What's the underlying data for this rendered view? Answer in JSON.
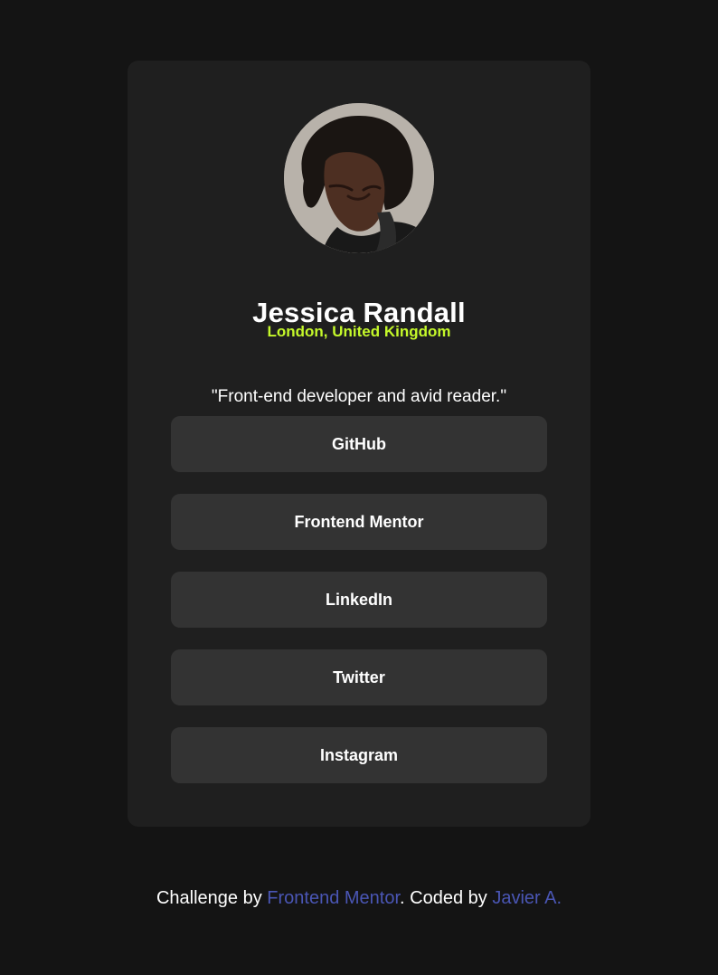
{
  "profile": {
    "name": "Jessica Randall",
    "location": "London, United Kingdom",
    "bio": "\"Front-end developer and avid reader.\"",
    "avatar_icon": "avatar-photo",
    "accent_color": "#c4f82a"
  },
  "links": [
    {
      "label": "GitHub"
    },
    {
      "label": "Frontend Mentor"
    },
    {
      "label": "LinkedIn"
    },
    {
      "label": "Twitter"
    },
    {
      "label": "Instagram"
    }
  ],
  "footer": {
    "prefix": "Challenge by ",
    "challenge_link": "Frontend Mentor",
    "middle": ". Coded by ",
    "author_link": "Javier A.",
    "link_color": "#4a56b5"
  },
  "colors": {
    "page_background": "#141414",
    "card_background": "#1f1f1f",
    "button_background": "#333333",
    "text": "#ffffff"
  }
}
